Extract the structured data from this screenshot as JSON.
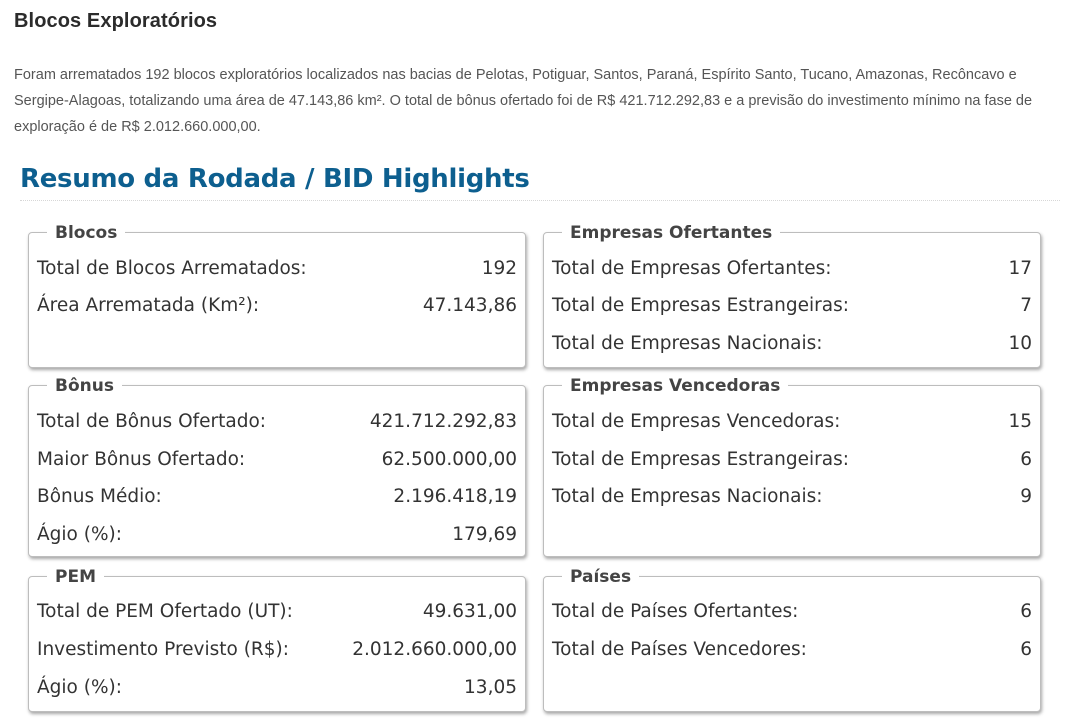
{
  "heading": "Blocos Exploratórios",
  "intro_lines": [
    "Foram arrematados 192 blocos exploratórios localizados nas bacias de Pelotas, Potiguar, Santos, Paraná, Espírito Santo, Tucano, Amazonas, Recôncavo e",
    "Sergipe-Alagoas, totalizando uma área de 47.143,86 km². O total de bônus ofertado foi de R$ 421.712.292,83 e a previsão do investimento mínimo na fase de",
    "exploração é de R$ 2.012.660.000,00."
  ],
  "section_title": "Resumo da Rodada / BID Highlights",
  "cards": {
    "blocos": {
      "title": "Blocos",
      "rows": [
        {
          "label": "Total de Blocos Arrematados:",
          "value": "192"
        },
        {
          "label": "Área Arrematada (Km²):",
          "value": "47.143,86"
        }
      ]
    },
    "empresas_ofertantes": {
      "title": "Empresas Ofertantes",
      "rows": [
        {
          "label": "Total de Empresas Ofertantes:",
          "value": "17"
        },
        {
          "label": "Total de Empresas Estrangeiras:",
          "value": "7"
        },
        {
          "label": "Total de Empresas Nacionais:",
          "value": "10"
        }
      ]
    },
    "bonus": {
      "title": "Bônus",
      "rows": [
        {
          "label": "Total de Bônus Ofertado:",
          "value": "421.712.292,83"
        },
        {
          "label": "Maior Bônus Ofertado:",
          "value": "62.500.000,00"
        },
        {
          "label": "Bônus Médio:",
          "value": "2.196.418,19"
        },
        {
          "label": "Ágio (%):",
          "value": "179,69"
        }
      ]
    },
    "empresas_vencedoras": {
      "title": "Empresas Vencedoras",
      "rows": [
        {
          "label": "Total de Empresas Vencedoras:",
          "value": "15"
        },
        {
          "label": "Total de Empresas Estrangeiras:",
          "value": "6"
        },
        {
          "label": "Total de Empresas Nacionais:",
          "value": "9"
        }
      ]
    },
    "pem": {
      "title": "PEM",
      "rows": [
        {
          "label": "Total de PEM Ofertado (UT):",
          "value": "49.631,00"
        },
        {
          "label": "Investimento Previsto (R$):",
          "value": "2.012.660.000,00"
        },
        {
          "label": "Ágio (%):",
          "value": "13,05"
        }
      ]
    },
    "paises": {
      "title": "Países",
      "rows": [
        {
          "label": "Total de Países Ofertantes:",
          "value": "6"
        },
        {
          "label": "Total de Países Vencedores:",
          "value": "6"
        }
      ]
    }
  }
}
